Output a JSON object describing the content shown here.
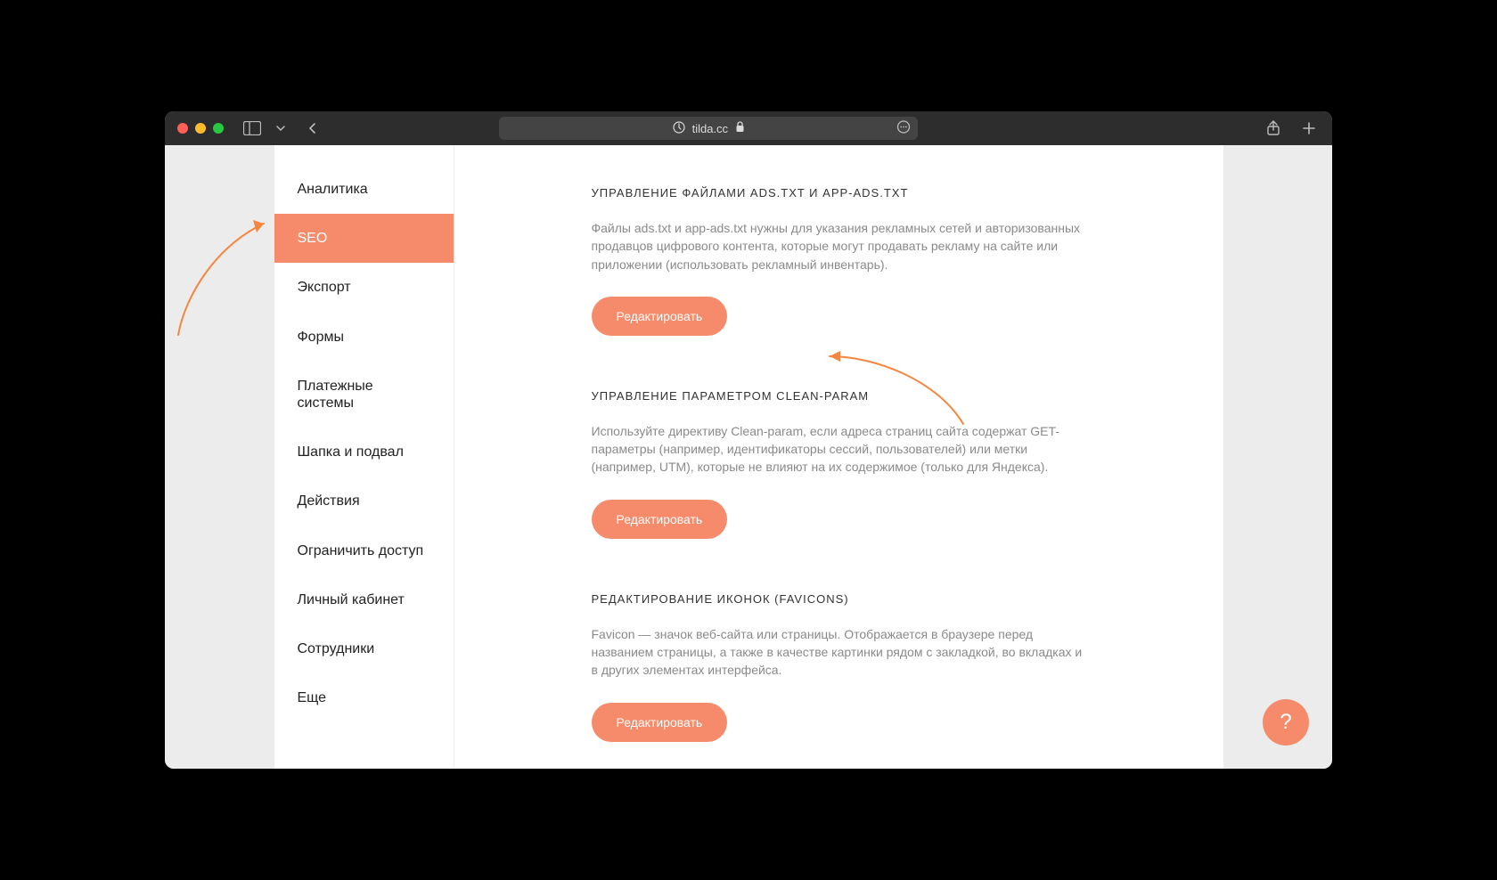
{
  "browser": {
    "url_host": "tilda.cc"
  },
  "sidebar": {
    "items": [
      {
        "label": "Аналитика",
        "active": false
      },
      {
        "label": "SEO",
        "active": true
      },
      {
        "label": "Экспорт",
        "active": false
      },
      {
        "label": "Формы",
        "active": false
      },
      {
        "label": "Платежные системы",
        "active": false
      },
      {
        "label": "Шапка и подвал",
        "active": false
      },
      {
        "label": "Действия",
        "active": false
      },
      {
        "label": "Ограничить доступ",
        "active": false
      },
      {
        "label": "Личный кабинет",
        "active": false
      },
      {
        "label": "Сотрудники",
        "active": false
      },
      {
        "label": "Еще",
        "active": false
      }
    ]
  },
  "sections": [
    {
      "title": "УПРАВЛЕНИЕ ФАЙЛАМИ ADS.TXT И APP-ADS.TXT",
      "desc": "Файлы ads.txt и app-ads.txt нужны для указания рекламных сетей и авторизованных продавцов цифрового контента, которые могут продавать рекламу на сайте или приложении (использовать рекламный инвентарь).",
      "button": "Редактировать"
    },
    {
      "title": "УПРАВЛЕНИЕ ПАРАМЕТРОМ CLEAN-PARAM",
      "desc": "Используйте директиву Clean-param, если адреса страниц сайта содержат GET-параметры (например, идентификаторы сессий, пользователей) или метки (например, UTM), которые не влияют на их содержимое (только для Яндекса).",
      "button": "Редактировать"
    },
    {
      "title": "РЕДАКТИРОВАНИЕ ИКОНОК (FAVICONS)",
      "desc": "Favicon — значок веб-сайта или страницы. Отображается в браузере перед названием страницы, а также в качестве картинки рядом с закладкой, во вкладках и в других элементах интерфейса.",
      "button": "Редактировать"
    }
  ],
  "help": {
    "label": "?"
  }
}
